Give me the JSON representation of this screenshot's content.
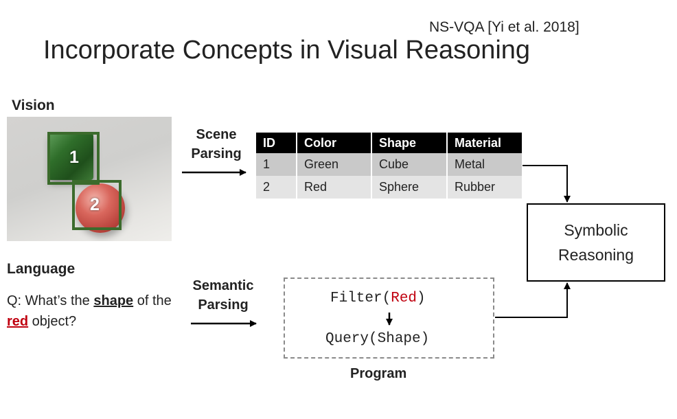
{
  "header": {
    "citation": "NS-VQA [Yi et al. 2018]",
    "title": "Incorporate Concepts in Visual Reasoning"
  },
  "vision": {
    "label": "Vision",
    "objects": [
      {
        "number": "1",
        "color": "#2f6e2a"
      },
      {
        "number": "2",
        "color": "#c24a42"
      }
    ]
  },
  "scene_parsing": {
    "label_line1": "Scene",
    "label_line2": "Parsing"
  },
  "table": {
    "headers": [
      "ID",
      "Color",
      "Shape",
      "Material"
    ],
    "rows": [
      [
        "1",
        "Green",
        "Cube",
        "Metal"
      ],
      [
        "2",
        "Red",
        "Sphere",
        "Rubber"
      ]
    ]
  },
  "reasoning": {
    "line1": "Symbolic",
    "line2": "Reasoning"
  },
  "language": {
    "label": "Language",
    "question_part1": "Q: What’s the ",
    "question_shape": "shape",
    "question_part2": " of the ",
    "question_red": "red",
    "question_part3": " object?"
  },
  "semantic_parsing": {
    "label_line1": "Semantic",
    "label_line2": "Parsing"
  },
  "program": {
    "filter_fn": "Filter(",
    "filter_arg": "Red",
    "filter_close": ")",
    "query": "Query(Shape)",
    "label": "Program"
  },
  "colors": {
    "accent_red": "#c0000f",
    "bbox_green": "#3b6b2c",
    "table_header": "#000000"
  }
}
